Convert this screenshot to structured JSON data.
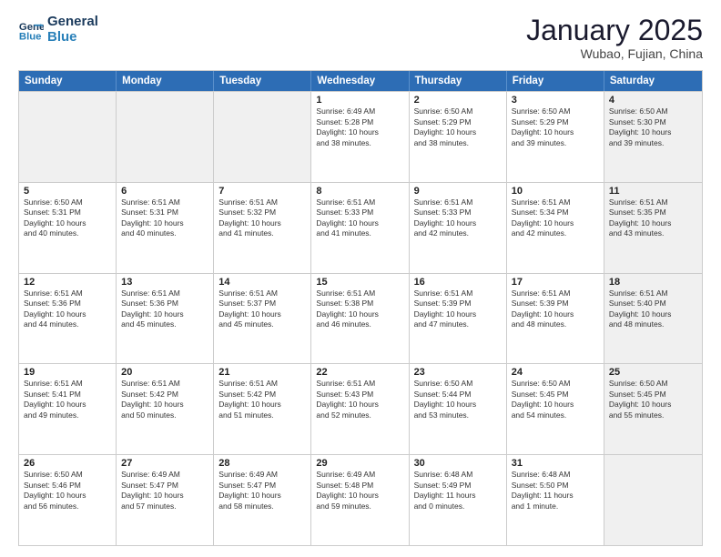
{
  "header": {
    "logo_line1": "General",
    "logo_line2": "Blue",
    "month_title": "January 2025",
    "location": "Wubao, Fujian, China"
  },
  "weekdays": [
    "Sunday",
    "Monday",
    "Tuesday",
    "Wednesday",
    "Thursday",
    "Friday",
    "Saturday"
  ],
  "weeks": [
    [
      {
        "day": "",
        "info": "",
        "shaded": true
      },
      {
        "day": "",
        "info": "",
        "shaded": true
      },
      {
        "day": "",
        "info": "",
        "shaded": true
      },
      {
        "day": "1",
        "info": "Sunrise: 6:49 AM\nSunset: 5:28 PM\nDaylight: 10 hours\nand 38 minutes."
      },
      {
        "day": "2",
        "info": "Sunrise: 6:50 AM\nSunset: 5:29 PM\nDaylight: 10 hours\nand 38 minutes."
      },
      {
        "day": "3",
        "info": "Sunrise: 6:50 AM\nSunset: 5:29 PM\nDaylight: 10 hours\nand 39 minutes."
      },
      {
        "day": "4",
        "info": "Sunrise: 6:50 AM\nSunset: 5:30 PM\nDaylight: 10 hours\nand 39 minutes.",
        "shaded": true
      }
    ],
    [
      {
        "day": "5",
        "info": "Sunrise: 6:50 AM\nSunset: 5:31 PM\nDaylight: 10 hours\nand 40 minutes."
      },
      {
        "day": "6",
        "info": "Sunrise: 6:51 AM\nSunset: 5:31 PM\nDaylight: 10 hours\nand 40 minutes."
      },
      {
        "day": "7",
        "info": "Sunrise: 6:51 AM\nSunset: 5:32 PM\nDaylight: 10 hours\nand 41 minutes."
      },
      {
        "day": "8",
        "info": "Sunrise: 6:51 AM\nSunset: 5:33 PM\nDaylight: 10 hours\nand 41 minutes."
      },
      {
        "day": "9",
        "info": "Sunrise: 6:51 AM\nSunset: 5:33 PM\nDaylight: 10 hours\nand 42 minutes."
      },
      {
        "day": "10",
        "info": "Sunrise: 6:51 AM\nSunset: 5:34 PM\nDaylight: 10 hours\nand 42 minutes."
      },
      {
        "day": "11",
        "info": "Sunrise: 6:51 AM\nSunset: 5:35 PM\nDaylight: 10 hours\nand 43 minutes.",
        "shaded": true
      }
    ],
    [
      {
        "day": "12",
        "info": "Sunrise: 6:51 AM\nSunset: 5:36 PM\nDaylight: 10 hours\nand 44 minutes."
      },
      {
        "day": "13",
        "info": "Sunrise: 6:51 AM\nSunset: 5:36 PM\nDaylight: 10 hours\nand 45 minutes."
      },
      {
        "day": "14",
        "info": "Sunrise: 6:51 AM\nSunset: 5:37 PM\nDaylight: 10 hours\nand 45 minutes."
      },
      {
        "day": "15",
        "info": "Sunrise: 6:51 AM\nSunset: 5:38 PM\nDaylight: 10 hours\nand 46 minutes."
      },
      {
        "day": "16",
        "info": "Sunrise: 6:51 AM\nSunset: 5:39 PM\nDaylight: 10 hours\nand 47 minutes."
      },
      {
        "day": "17",
        "info": "Sunrise: 6:51 AM\nSunset: 5:39 PM\nDaylight: 10 hours\nand 48 minutes."
      },
      {
        "day": "18",
        "info": "Sunrise: 6:51 AM\nSunset: 5:40 PM\nDaylight: 10 hours\nand 48 minutes.",
        "shaded": true
      }
    ],
    [
      {
        "day": "19",
        "info": "Sunrise: 6:51 AM\nSunset: 5:41 PM\nDaylight: 10 hours\nand 49 minutes."
      },
      {
        "day": "20",
        "info": "Sunrise: 6:51 AM\nSunset: 5:42 PM\nDaylight: 10 hours\nand 50 minutes."
      },
      {
        "day": "21",
        "info": "Sunrise: 6:51 AM\nSunset: 5:42 PM\nDaylight: 10 hours\nand 51 minutes."
      },
      {
        "day": "22",
        "info": "Sunrise: 6:51 AM\nSunset: 5:43 PM\nDaylight: 10 hours\nand 52 minutes."
      },
      {
        "day": "23",
        "info": "Sunrise: 6:50 AM\nSunset: 5:44 PM\nDaylight: 10 hours\nand 53 minutes."
      },
      {
        "day": "24",
        "info": "Sunrise: 6:50 AM\nSunset: 5:45 PM\nDaylight: 10 hours\nand 54 minutes."
      },
      {
        "day": "25",
        "info": "Sunrise: 6:50 AM\nSunset: 5:45 PM\nDaylight: 10 hours\nand 55 minutes.",
        "shaded": true
      }
    ],
    [
      {
        "day": "26",
        "info": "Sunrise: 6:50 AM\nSunset: 5:46 PM\nDaylight: 10 hours\nand 56 minutes."
      },
      {
        "day": "27",
        "info": "Sunrise: 6:49 AM\nSunset: 5:47 PM\nDaylight: 10 hours\nand 57 minutes."
      },
      {
        "day": "28",
        "info": "Sunrise: 6:49 AM\nSunset: 5:47 PM\nDaylight: 10 hours\nand 58 minutes."
      },
      {
        "day": "29",
        "info": "Sunrise: 6:49 AM\nSunset: 5:48 PM\nDaylight: 10 hours\nand 59 minutes."
      },
      {
        "day": "30",
        "info": "Sunrise: 6:48 AM\nSunset: 5:49 PM\nDaylight: 11 hours\nand 0 minutes."
      },
      {
        "day": "31",
        "info": "Sunrise: 6:48 AM\nSunset: 5:50 PM\nDaylight: 11 hours\nand 1 minute."
      },
      {
        "day": "",
        "info": "",
        "shaded": true
      }
    ]
  ]
}
